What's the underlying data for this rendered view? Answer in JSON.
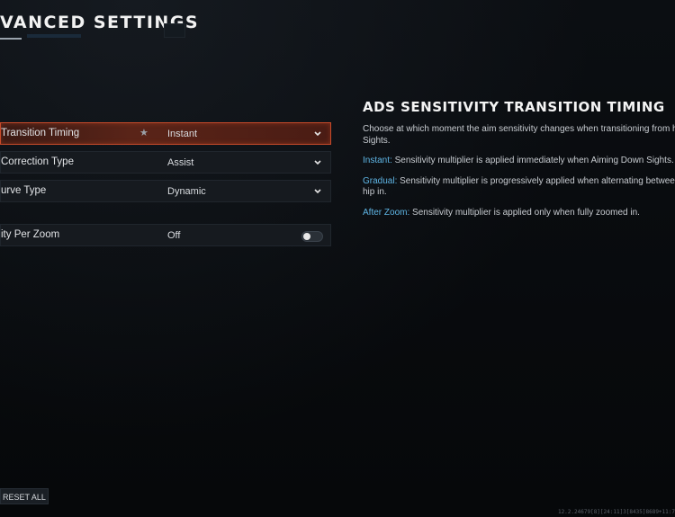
{
  "header": {
    "title": "VANCED SETTINGS"
  },
  "settings": {
    "rows": [
      {
        "label": "Transition Timing",
        "value": "Instant",
        "starred": true,
        "control": "dropdown",
        "selected": true
      },
      {
        "label": "Correction Type",
        "value": "Assist",
        "control": "dropdown",
        "selected": false
      },
      {
        "label": "urve Type",
        "value": "Dynamic",
        "control": "dropdown",
        "selected": false
      },
      {
        "label": "ity Per Zoom",
        "value": "Off",
        "control": "toggle",
        "toggle_on": false,
        "selected": false
      }
    ],
    "star_glyph": "★"
  },
  "info": {
    "title": "ADS SENSITIVITY TRANSITION TIMING",
    "intro": "Choose at which moment the aim sensitivity changes when transitioning from hip Sights.",
    "options": [
      {
        "keyword": "Instant:",
        "text": " Sensitivity multiplier is applied immediately when Aiming Down Sights."
      },
      {
        "keyword": "Gradual:",
        "text": " Sensitivity multiplier is progressively applied when alternating between hip in."
      },
      {
        "keyword": "After Zoom:",
        "text": " Sensitivity multiplier is applied only when fully zoomed in."
      }
    ]
  },
  "footer": {
    "reset_label": "RESET ALL",
    "build_string": "12.2.24679[8][24:11]3[8435]8689+11:7"
  },
  "colors": {
    "accent_selected": "#c74a2a",
    "keyword": "#5fb6e6"
  }
}
